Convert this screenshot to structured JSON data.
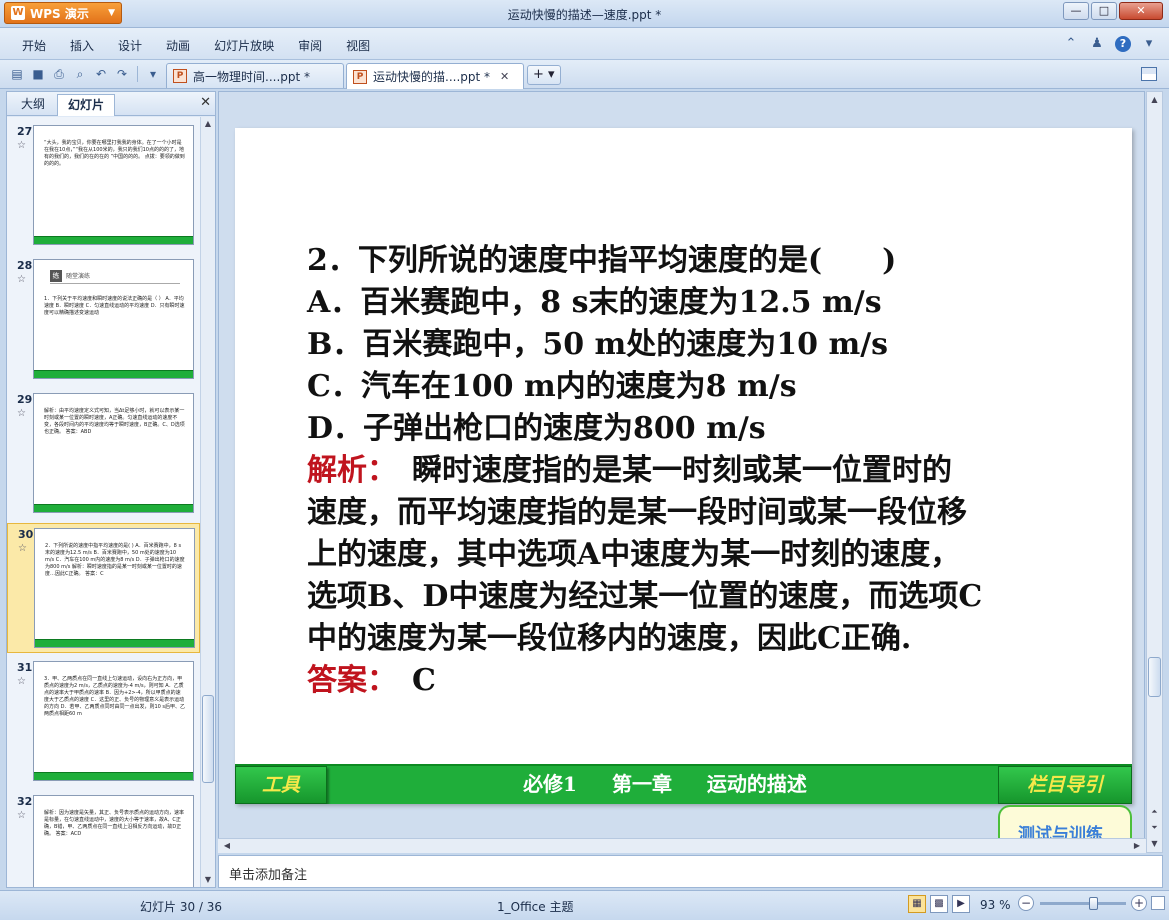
{
  "app": {
    "name": "WPS 演示",
    "window_title": "运动快慢的描述—速度.ppt *",
    "controls": {
      "minimize": "—",
      "maximize": "□",
      "close": "✕"
    }
  },
  "menu": {
    "items": [
      "开始",
      "插入",
      "设计",
      "动画",
      "幻灯片放映",
      "审阅",
      "视图"
    ]
  },
  "tabs": [
    {
      "label": "高一物理时间....ppt *",
      "active": false
    },
    {
      "label": "运动快慢的描....ppt *",
      "active": true
    }
  ],
  "new_tab": "+ ▾",
  "left_panel": {
    "tab_outline": "大纲",
    "tab_slides": "幻灯片",
    "close": "✕",
    "slides": [
      {
        "num": "27",
        "star": "☆",
        "text": "“大头，我的宝贝，你要在哪里打我我的身体。在了一个小时是在我在10点，”“我在从100米的，我只的我们10点的的的了，地有的我们的，我们的在的在的 ”中国的的的。 点拨：要领的做到的的的。",
        "selected": false
      },
      {
        "num": "28",
        "star": "☆",
        "text": "1．下列关于平均速度和瞬时速度的说法正确的是（ ） A．平均速度 B．瞬时速度 C．匀速直线运动的平均速度 D．只有瞬时速度可以精确描述变速运动",
        "header": "随堂演练",
        "selected": false
      },
      {
        "num": "29",
        "star": "☆",
        "text": "解析：由平均速度定义式可知，当Δt足够小时，就可以表示某一时刻或某一位置的瞬时速度，A正确。匀速直线运动的速度不变，各段时间内的平均速度均等于瞬时速度，B正确。C、D选项也正确。 答案：ABD",
        "selected": false
      },
      {
        "num": "30",
        "star": "☆",
        "text": "2．下列所说的速度中指平均速度的是( ) A．百米赛跑中，8 s末的速度为12.5 m/s B．百米赛跑中，50 m处的速度为10 m/s C．汽车在100 m内的速度为8 m/s D．子弹出枪口的速度为800 m/s 解析：瞬时速度指的是某一时刻或某一位置时的速度…因此C正确。 答案：C",
        "selected": true
      },
      {
        "num": "31",
        "star": "☆",
        "text": "3．甲、乙两质点在同一直线上匀速运动，设向右为正方向，甲质点的速度为2 m/s，乙质点的速度为-4 m/s，则可知 A．乙质点的速率大于甲质点的速率 B．因为+2>-4，所以甲质点的速度大于乙质点的速度 C．这里的正、负号的物理意义是表示运动的方向 D．若甲、乙两质点同时由同一点出发，则10 s后甲、乙两质点相距60 m",
        "selected": false
      },
      {
        "num": "32",
        "star": "☆",
        "text": "解析：因为速度是矢量，其正、负号表示质点的运动方向，速率是标量，在匀速直线运动中，速度的大小等于速率，故A、C正确，B错，甲、乙两质点在同一直线上沿相反方向运动，故D正确。 答案：ACD",
        "selected": false
      }
    ]
  },
  "slide": {
    "question": "2．下列所说的速度中指平均速度的是(　　)",
    "options": [
      "A．百米赛跑中，8 s末的速度为12.5 m/s",
      "B．百米赛跑中，50 m处的速度为10 m/s",
      "C．汽车在100 m内的速度为8 m/s",
      "D．子弹出枪口的速度为800 m/s"
    ],
    "analysis_label": "解析：",
    "analysis_lines": [
      "　瞬时速度指的是某一时刻或某一位置时的",
      "速度，而平均速度指的是某一段时间或某一段位移",
      "上的速度，其中选项A中速度为某一时刻的速度，",
      "选项B、D中速度为经过某一位置的速度，而选项C",
      "中的速度为某一段位移内的速度，因此C正确."
    ],
    "answer_label": "答案：",
    "answer_value": "　C",
    "footer": {
      "left_button": "工具",
      "center_1": "必修1",
      "center_2": "第一章",
      "center_3": "运动的描述",
      "right_button": "栏目导引"
    },
    "extra_button": "测试与训练"
  },
  "notes_placeholder": "单击添加备注",
  "status": {
    "slide_counter": "幻灯片 30 / 36",
    "theme": "1_Office 主题",
    "zoom": "93 %",
    "zoom_fraction": 0.62
  }
}
